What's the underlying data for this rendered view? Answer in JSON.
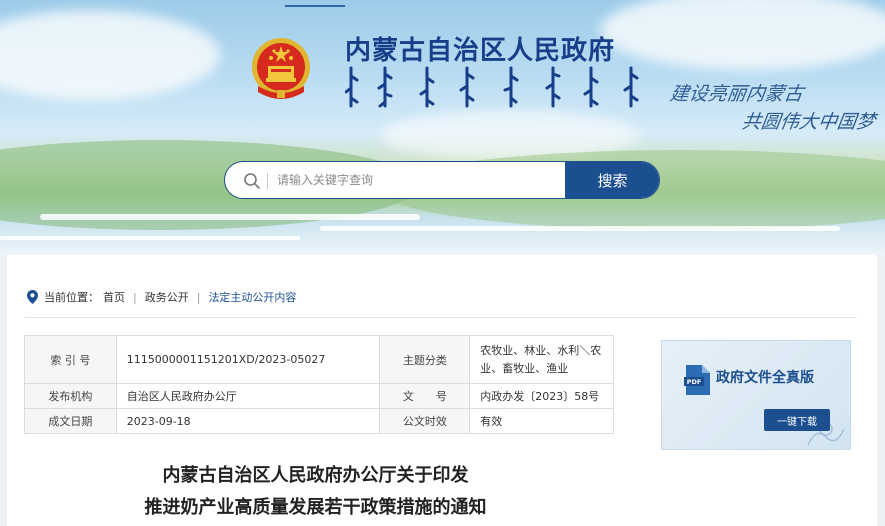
{
  "header": {
    "site_title": "内蒙古自治区人民政府",
    "slogan_line1": "建设亮丽内蒙古",
    "slogan_line2": "共圆伟大中国梦"
  },
  "search": {
    "placeholder": "请输入关键字查询",
    "button_label": "搜索"
  },
  "breadcrumb": {
    "prefix": "当前位置：",
    "items": [
      "首页",
      "政务公开",
      "法定主动公开内容"
    ]
  },
  "meta_table": {
    "rows": [
      {
        "k1": "索 引 号",
        "v1": "1115000001151201XD/2023-05027",
        "k2": "主题分类",
        "v2": "农牧业、林业、水利＼农业、畜牧业、渔业"
      },
      {
        "k1": "发布机构",
        "v1": "自治区人民政府办公厅",
        "k2": "文　　号",
        "v2": "内政办发〔2023〕58号"
      },
      {
        "k1": "成文日期",
        "v1": "2023-09-18",
        "k2": "公文时效",
        "v2": "有效"
      }
    ]
  },
  "doc_card": {
    "title": "政府文件全真版",
    "download_label": "一键下载"
  },
  "notice": {
    "title_line1": "内蒙古自治区人民政府办公厅关于印发",
    "title_line2": "推进奶产业高质量发展若干政策措施的通知"
  },
  "colors": {
    "brand_blue": "#1b4f8f",
    "title_blue": "#173e88"
  }
}
